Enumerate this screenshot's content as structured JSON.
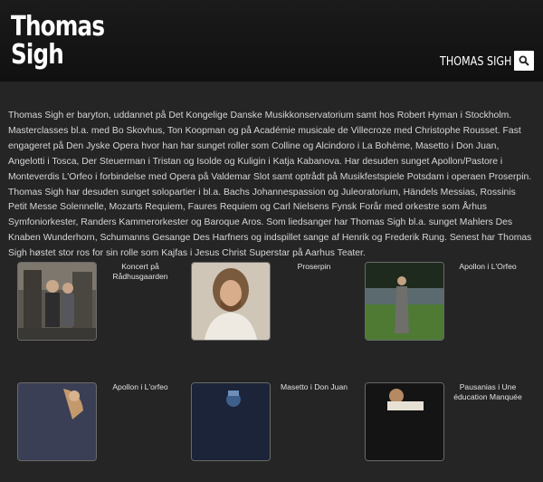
{
  "header": {
    "logo_line1": "Thomas",
    "logo_line2": "Sigh",
    "nav_link": "THOMAS SIGH",
    "search_icon": "search-icon"
  },
  "main": {
    "bio": "Thomas Sigh er baryton, uddannet på Det Kongelige Danske Musikkonservatorium samt hos Robert Hyman i Stockholm. Masterclasses bl.a. med Bo Skovhus, Ton Koopman og på Académie musicale de Villecroze med Christophe Rousset. Fast engageret på Den Jyske Opera hvor han har sunget roller som Colline og Alcindoro i La Bohème, Masetto i Don Juan, Angelotti i Tosca, Der Steuerman i Tristan og Isolde og Kuligin i Katja Kabanova. Har desuden sunget Apollon/Pastore i Monteverdis L'Orfeo i forbindelse med Opera på Valdemar Slot samt optrådt på Musikfestspiele Potsdam i operaen Proserpin. Thomas Sigh har desuden sunget solopartier i bl.a. Bachs Johannespassion og Juleoratorium, Händels Messias, Rossinis Petit Messe Solennelle, Mozarts Requiem, Faures Requiem og Carl Nielsens Fynsk Forår med orkestre som Århus Symfoniorkester, Randers Kammerorkester og Baroque Aros. Som liedsanger har Thomas Sigh bl.a. sunget Mahlers Des Knaben Wunderhorn, Schumanns Gesange Des Harfners og indspillet sange af Henrik og Frederik Rung. Senest har Thomas Sigh høstet stor ros for sin rolle som Kajfas i Jesus Christ Superstar på Aarhus Teater.",
    "gallery": [
      {
        "caption": "Koncert på Rådhusgaarden"
      },
      {
        "caption": "Proserpin"
      },
      {
        "caption": "Apollon i L'Orfeo"
      },
      {
        "caption": "Apollon i L'orfeo"
      },
      {
        "caption": "Masetto i Don Juan"
      },
      {
        "caption": "Pausanias i Une éducation Manquée"
      }
    ]
  }
}
